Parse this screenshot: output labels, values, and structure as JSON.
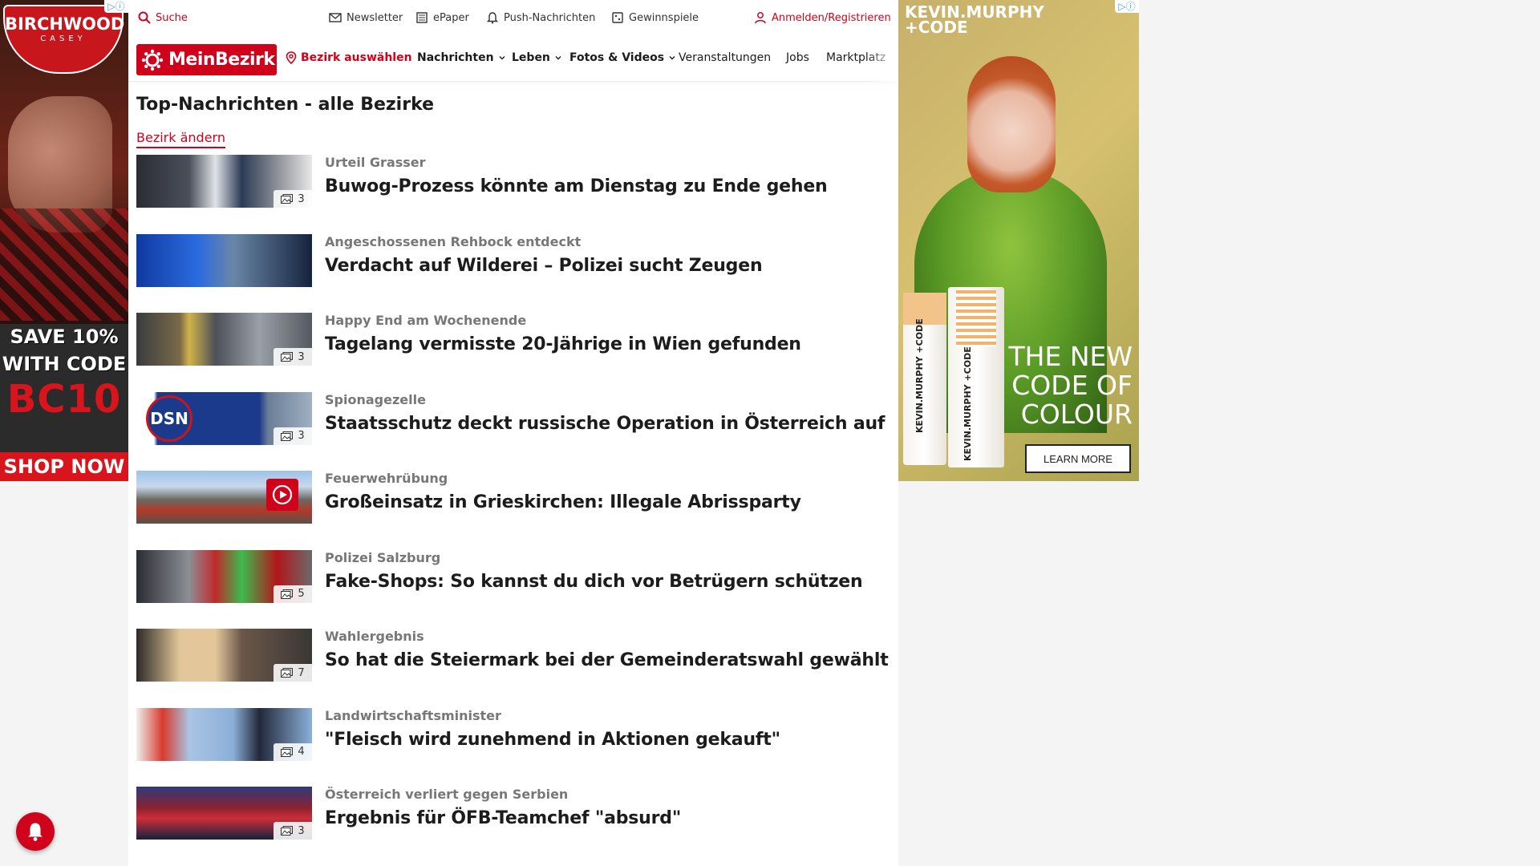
{
  "ad_left": {
    "brand": "BIRCHWOOD",
    "brand_sub": "CASEY",
    "promo_line1": "SAVE 10%",
    "promo_line2": "WITH CODE",
    "promo_code": "BC10",
    "cta": "SHOP NOW",
    "adchoices_icon": "adchoices-icon"
  },
  "topbar": {
    "search": "Suche",
    "newsletter": "Newsletter",
    "epaper": "ePaper",
    "push": "Push-Nachrichten",
    "gewinnspiele": "Gewinnspiele",
    "login": "Anmelden/Registrieren"
  },
  "navbar": {
    "brand": "MeinBezirk",
    "choose_district": "Bezirk auswählen",
    "items": [
      "Nachrichten",
      "Leben",
      "Fotos & Videos",
      "Veranstaltungen",
      "Jobs",
      "Marktplatz"
    ]
  },
  "page": {
    "title": "Top-Nachrichten - alle Bezirke",
    "change_district": "Bezirk ändern"
  },
  "articles": [
    {
      "kicker": "Urteil Grasser",
      "headline": "Buwog-Prozess könnte am Dienstag zu Ende gehen",
      "photos": "3"
    },
    {
      "kicker": "Angeschossenen Rehbock entdeckt",
      "headline": "Verdacht auf Wilderei – Polizei sucht Zeugen",
      "photos": ""
    },
    {
      "kicker": "Happy End am Wochenende",
      "headline": "Tagelang vermisste 20-Jährige in Wien gefunden",
      "photos": "3"
    },
    {
      "kicker": "Spionagezelle",
      "headline": "Staatsschutz deckt russische Operation in Österreich auf",
      "photos": "3",
      "thumb_text": "DSN"
    },
    {
      "kicker": "Feuerwehrübung",
      "headline": "Großeinsatz in Grieskirchen: Illegale Abrissparty",
      "photos": "",
      "video": true
    },
    {
      "kicker": "Polizei Salzburg",
      "headline": "Fake-Shops: So kannst du dich vor Betrügern schützen",
      "photos": "5"
    },
    {
      "kicker": "Wahlergebnis",
      "headline": "So hat die Steiermark bei der Gemeinderatswahl gewählt",
      "photos": "7"
    },
    {
      "kicker": "Landwirtschaftsminister",
      "headline": "\"Fleisch wird zunehmend in Aktionen gekauft\"",
      "photos": "4"
    },
    {
      "kicker": "Österreich verliert gegen Serbien",
      "headline": "Ergebnis für ÖFB-Teamchef \"absurd\"",
      "photos": "3"
    }
  ],
  "ad_right": {
    "brand_line1": "KEVIN.MURPHY",
    "brand_line2": "+CODE",
    "tube_label": "KEVIN.MURPHY +CODE",
    "slogan_line1": "THE NEW",
    "slogan_line2": "CODE OF",
    "slogan_line3": "COLOUR",
    "cta": "LEARN MORE"
  },
  "colors": {
    "accent": "#d0021b",
    "text": "#1c1c1c",
    "kicker": "#777777"
  }
}
